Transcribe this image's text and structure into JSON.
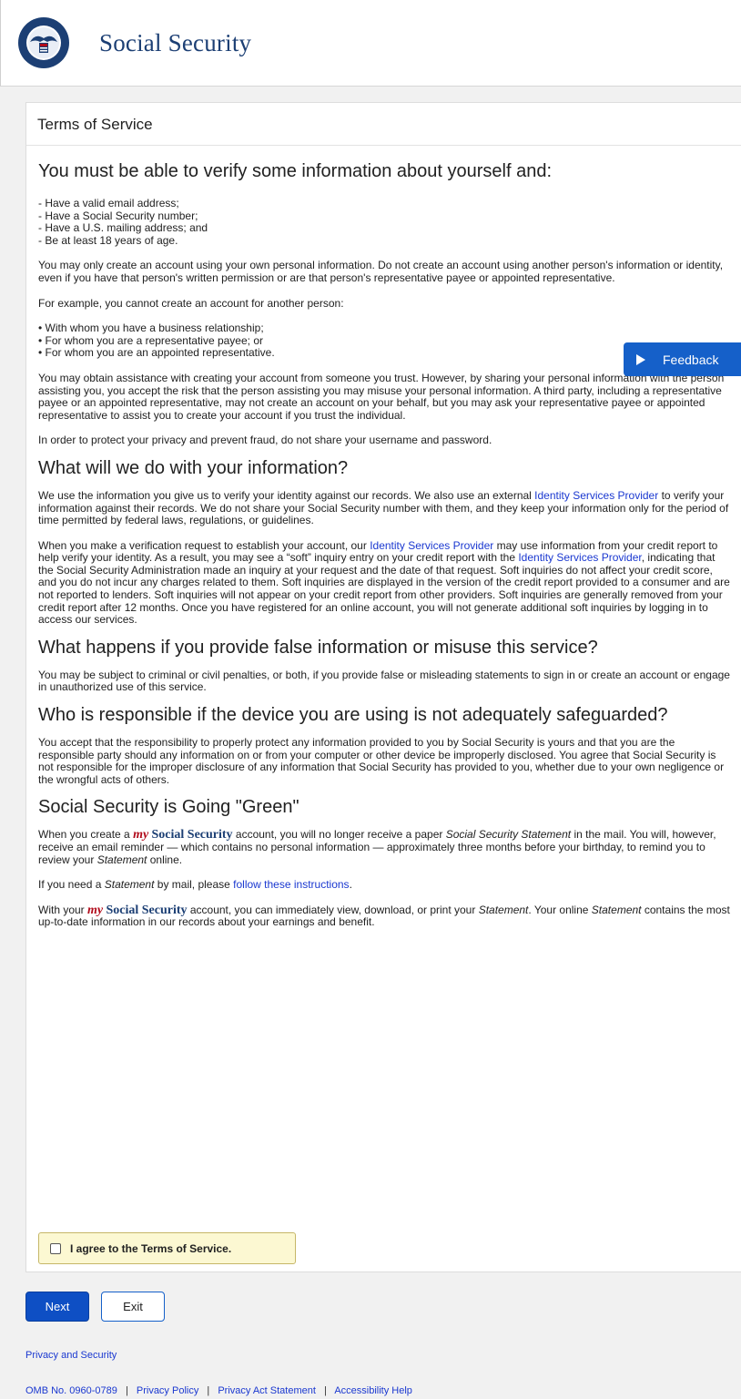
{
  "header": {
    "brand": "Social Security",
    "seal_text_top": "SOCIAL SECURITY",
    "seal_text_bottom": "ADMINISTRATION",
    "seal_usa": "USA"
  },
  "card": {
    "title": "Terms of Service",
    "heading_verify": "You must be able to verify some information about yourself and:",
    "requirements": [
      "- Have a valid email address;",
      "- Have a Social Security number;",
      "- Have a U.S. mailing address; and",
      "- Be at least 18 years of age."
    ],
    "p_own_info": "You may only create an account using your own personal information. Do not create an account using another person's information or identity, even if you have that person's written permission or are that person's representative payee or appointed representative.",
    "p_example": "For example, you cannot create an account for another person:",
    "bullets": [
      "• With whom you have a business relationship;",
      "• For whom you are a representative payee; or",
      "• For whom you are an appointed representative."
    ],
    "p_assistance": "You may obtain assistance with creating your account from someone you trust. However, by sharing your personal information with the person assisting you, you accept the risk that the person assisting you may misuse your personal information. A third party, including a representative payee or an appointed representative, may not create an account on your behalf, but you may ask your representative payee or appointed representative to assist you to create your account if you trust the individual.",
    "p_privacy": "In order to protect your privacy and prevent fraud, do not share your username and password.",
    "heading_info": "What will we do with your information?",
    "p_info1_a": "We use the information you give us to verify your identity against our records. We also use an external ",
    "link_isp": "Identity Services Provider",
    "p_info1_b": " to verify your information against their records. We do not share your Social Security number with them, and they keep your information only for the period of time permitted by federal laws, regulations, or guidelines.",
    "p_info2_a": "When you make a verification request to establish your account, our ",
    "p_info2_b": " may use information from your credit report to help verify your identity. As a result, you may see a “soft” inquiry entry on your credit report with the ",
    "p_info2_c": ", indicating that the Social Security Administration made an inquiry at your request and the date of that request. Soft inquiries do not affect your credit score, and you do not incur any charges related to them. Soft inquiries are displayed in the version of the credit report provided to a consumer and are not reported to lenders. Soft inquiries will not appear on your credit report from other providers. Soft inquiries are generally removed from your credit report after 12 months. Once you have registered for an online account, you will not generate additional soft inquiries by logging in to access our services.",
    "heading_false": "What happens if you provide false information or misuse this service?",
    "p_false": "You may be subject to criminal or civil penalties, or both, if you provide false or misleading statements to sign in or create an account or engage in unauthorized use of this service.",
    "heading_device": "Who is responsible if the device you are using is not adequately safeguarded?",
    "p_device": "You accept that the responsibility to properly protect any information provided to you by Social Security is yours and that you are the responsible party should any information on or from your computer or other device be improperly disclosed. You agree that Social Security is not responsible for the improper disclosure of any information that Social Security has provided to you, whether due to your own negligence or the wrongful acts of others.",
    "heading_green": "Social Security is Going \"Green\"",
    "my": "my",
    "social_security": "Social Security",
    "p_green1_a": "When you create a ",
    "p_green1_b": " account, you will no longer receive a paper ",
    "statement_full": "Social Security Statement",
    "p_green1_c": " in the mail. You will, however, receive an email reminder — which contains no personal information — approximately three months before your birthday, to remind you to review your ",
    "statement": "Statement",
    "p_green1_d": " online.",
    "p_mail_a": "If you need a ",
    "p_mail_b": " by mail, please ",
    "link_follow": "follow these instructions",
    "p_mail_c": ".",
    "p_with_a": "With your ",
    "p_with_b": " account, you can immediately view, download, or print your ",
    "p_with_c": ". Your online ",
    "p_with_d": " contains the most up-to-date information in our records about your earnings and benefit.",
    "period": ".",
    "space": " ",
    "agree_label": "I agree to the Terms of Service."
  },
  "feedback": {
    "label": "Feedback"
  },
  "buttons": {
    "next": "Next",
    "exit": "Exit"
  },
  "footer": {
    "privacy_security": "Privacy and Security",
    "omb": "OMB No. 0960-0789",
    "sep": "|",
    "privacy_policy": "Privacy Policy",
    "privacy_act": "Privacy Act Statement",
    "accessibility": "Accessibility Help"
  },
  "colors": {
    "primary": "#0e4fc4",
    "link": "#1a38d0",
    "brand_navy": "#1c3f74",
    "agree_bg": "#fcf8d2"
  }
}
